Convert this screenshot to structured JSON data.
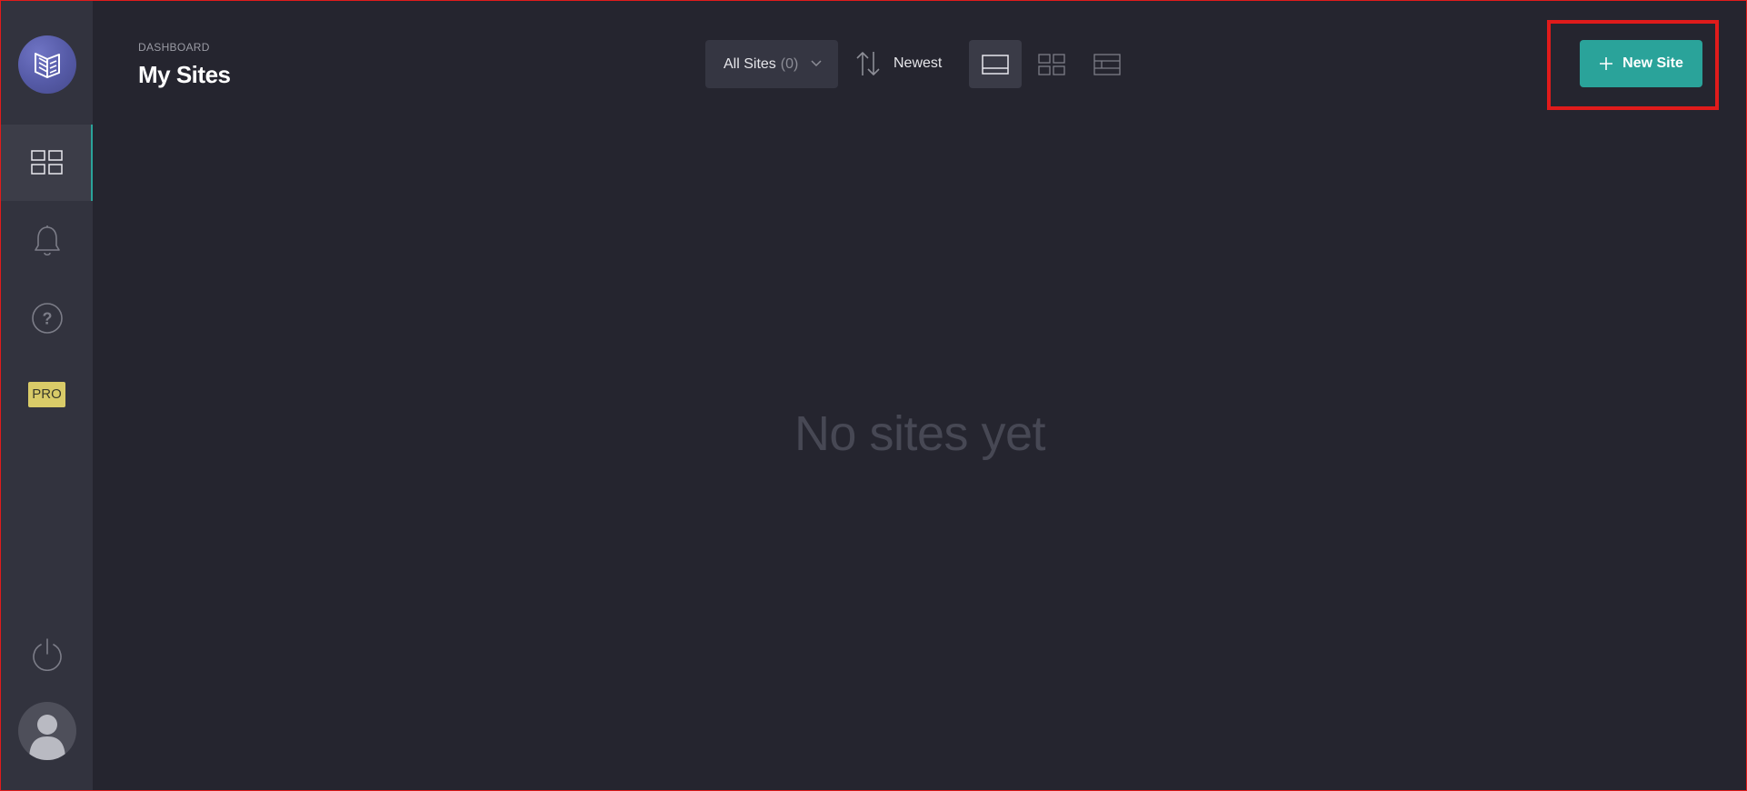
{
  "header": {
    "breadcrumb": "DASHBOARD",
    "title": "My Sites"
  },
  "toolbar": {
    "filter": {
      "label": "All Sites",
      "count": "(0)"
    },
    "sort": {
      "label": "Newest"
    },
    "views": [
      {
        "name": "single-column-view",
        "active": true
      },
      {
        "name": "grid-view",
        "active": false
      },
      {
        "name": "list-view",
        "active": false
      }
    ],
    "new_site_label": "New Site"
  },
  "sidebar": {
    "items": [
      {
        "name": "dashboard",
        "icon": "grid-icon",
        "active": true
      },
      {
        "name": "notifications",
        "icon": "bell-icon",
        "active": false
      },
      {
        "name": "help",
        "icon": "question-icon",
        "active": false
      },
      {
        "name": "pro",
        "label": "PRO",
        "active": false
      }
    ],
    "power_icon": "power-icon",
    "avatar_icon": "user-avatar-icon"
  },
  "main": {
    "empty_message": "No sites yet"
  },
  "colors": {
    "accent": "#2aa39a",
    "sidebar": "#32333e",
    "background": "#25252f",
    "pro_badge": "#d9cb68",
    "highlight": "#e01b1b"
  }
}
